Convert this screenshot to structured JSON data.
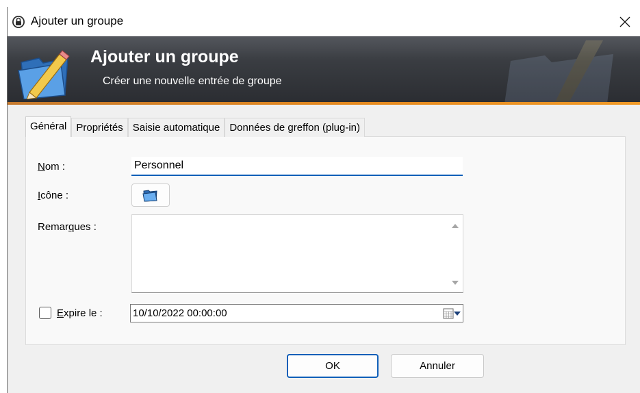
{
  "window": {
    "title": "Ajouter un groupe",
    "close_glyph": "✕",
    "title_icon": "keepass-lock-icon"
  },
  "banner": {
    "title": "Ajouter un groupe",
    "subtitle": "Créer une nouvelle entrée de groupe",
    "icon": "folder-pencil-icon",
    "accent": "#e58a20"
  },
  "tabs": [
    {
      "label": "Général",
      "active": true
    },
    {
      "label": "Propriétés",
      "active": false
    },
    {
      "label": "Saisie automatique",
      "active": false
    },
    {
      "label": "Données de greffon (plug-in)",
      "active": false
    }
  ],
  "form": {
    "name": {
      "label_u": "N",
      "label_rest": "om :",
      "value": "Personnel"
    },
    "icon": {
      "label_u": "I",
      "label_rest": "cône :",
      "icon": "folder-icon"
    },
    "notes": {
      "label_pre": "Remar",
      "label_u": "q",
      "label_rest": "ues :",
      "value": ""
    },
    "expires": {
      "label_u": "E",
      "label_rest": "xpire le :",
      "checked": false,
      "value": "10/10/2022 00:00:00"
    }
  },
  "buttons": {
    "ok": "OK",
    "cancel": "Annuler"
  },
  "colors": {
    "focus_blue": "#0f5fb8",
    "banner_dark": "#2a2c31"
  }
}
